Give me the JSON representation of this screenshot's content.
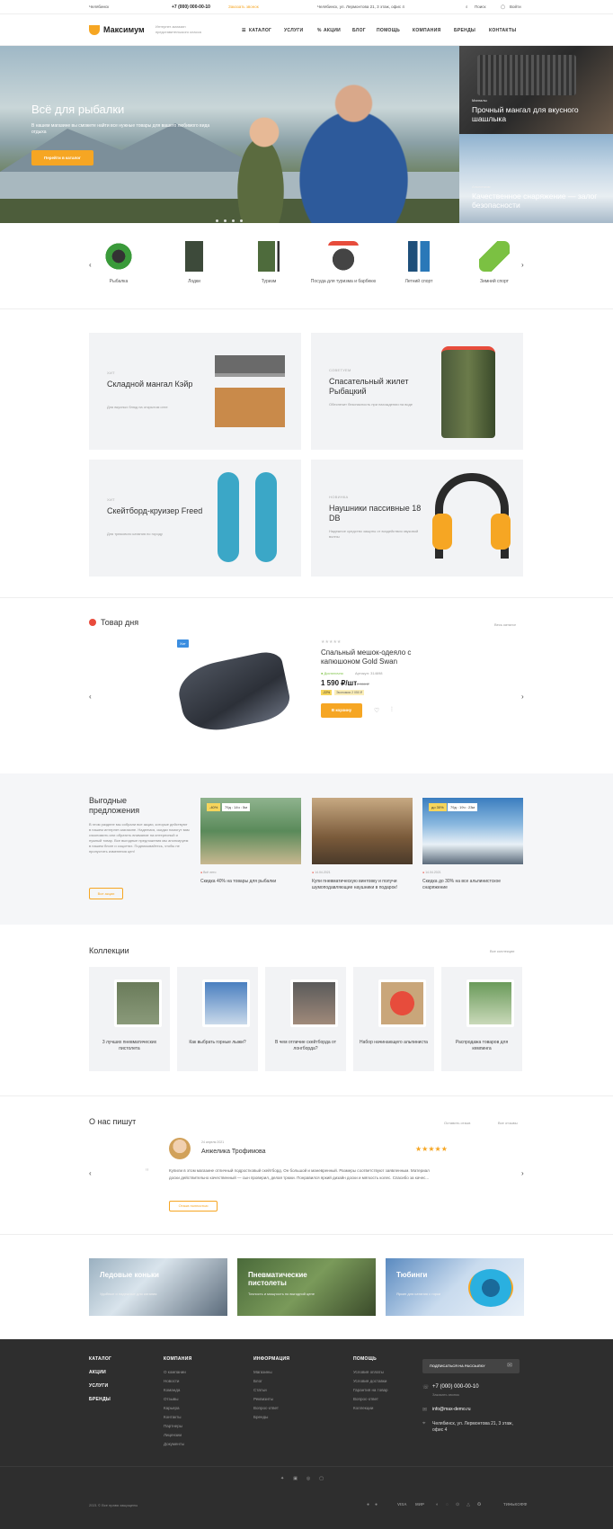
{
  "topbar": {
    "city": "Челябинск",
    "phone": "+7 (000) 000-00-10",
    "callback": "Заказать звонок",
    "address": "Челябинск, ул. Лермонтова 21, 3 этаж, офис 4",
    "search": "Поиск",
    "login": "Войти"
  },
  "brand": {
    "name": "Максимум",
    "tagline": "Интернет-магазин представительского класса",
    "accent": "#f6a623"
  },
  "nav": [
    "КАТАЛОГ",
    "УСЛУГИ",
    "АКЦИИ",
    "БЛОГ",
    "ПОМОЩЬ",
    "КОМПАНИЯ",
    "БРЕНДЫ",
    "КОНТАКТЫ"
  ],
  "hero": {
    "title": "Всё для рыбалки",
    "text": "В нашем магазине вы сможете найти все нужные товары для вашего любимого вида отдыха",
    "button": "Перейти в каталог"
  },
  "side_banners": [
    {
      "sub": "Мангалы",
      "title": "Прочный мангал для вкусного шашлыка"
    },
    {
      "sub": "Альпинизм",
      "title": "Качественное снаряжение — залог безопасности"
    }
  ],
  "categories": [
    "Рыбалка",
    "Лодки",
    "Туризм",
    "Посуда для туризма и барбекю",
    "Летний спорт",
    "Зимний спорт"
  ],
  "promos": [
    {
      "label": "ХИТ",
      "title": "Складной мангал Кэйр",
      "desc": "Для вкусных блюд на открытом огне"
    },
    {
      "label": "СОВЕТУЕМ",
      "title": "Спасательный жилет Рыбацкий",
      "desc": "Обеспечит безопасность при нахождении на воде"
    },
    {
      "label": "ХИТ",
      "title": "Скейтборд-круизер Freed",
      "desc": "Для трюкового катания по городу"
    },
    {
      "label": "НОВИНКА",
      "title": "Наушники пассивные 18 DB",
      "desc": "Надежное средство защиты от воздействия звуковой волны"
    }
  ],
  "day": {
    "title": "Товар дня",
    "all_link": "Весь каталог",
    "badge": "Хит",
    "name": "Спальный мешок-одеяло с капюшоном Gold Swan",
    "stock": "Достаточно",
    "article": "Артикул: 314698",
    "price": "1 590 ₽/шт",
    "old_price": "2 050 ₽",
    "discount": "-22%",
    "economy": "Экономия 2 050 ₽",
    "buy": "В корзину"
  },
  "offers": {
    "title": "Выгодные предложения",
    "text": "В этом разделе мы собрали все акции, которые действуют в нашем интернет-магазине. Надеемся, скидки помогут вам сэкономить или обратить внимание на интересный и нужный товар. Все выгодные предложения мы анонсируем в нашем блоге и соцсетях. Подписывайтесь, чтобы не пропустить изменения цен!",
    "button": "Все акции",
    "items": [
      {
        "badge": "-40%",
        "timer": "79д : 14ч : 5м",
        "date": "Всё лето",
        "title": "Скидка 40% на товары для рыбалки"
      },
      {
        "badge": "",
        "timer": "",
        "date": "14.04.2021",
        "title": "Купи пневматическую винтовку и получи шумоподавляющие наушники в подарок!"
      },
      {
        "badge": "до 30%",
        "timer": "79д : 19ч : 23м",
        "date": "14.04.2021",
        "title": "Скидка до 30% на все альпинистское снаряжение"
      }
    ]
  },
  "collections": {
    "title": "Коллекции",
    "all_link": "Все коллекции",
    "items": [
      "3 лучших пневматических пистолета",
      "Как выбрать горные лыжи?",
      "В чем отличие скейтборда от лонгборда?",
      "Набор начинающего альпиниста",
      "Распродажа товаров для кемпинга"
    ]
  },
  "reviews": {
    "title": "О нас пишут",
    "leave": "Оставить отзыв",
    "all_link": "Все отзывы",
    "date": "24 апреля 2021",
    "author": "Анжелика Трофимова",
    "stars": "★★★★★",
    "text": "Купили в этом магазине отличный подростковый скейтборд. Он большой и маневренный. Размеры соответствуют заявленным. Материал доски действительно качественный — сын проверил, делая трюки. Понравился яркий дизайн доски и мягкость колес. Спасибо за качес...",
    "more": "Отзыв полностью"
  },
  "banners": [
    {
      "title": "Ледовые коньки",
      "sub": "Удобные и надежные для катания"
    },
    {
      "title": "Пневматические пистолеты",
      "sub": "Точность и мощность по выгодной цене"
    },
    {
      "title": "Тюбинги",
      "sub": "Яркие для катания с горки"
    }
  ],
  "footer": {
    "main": [
      "КАТАЛОГ",
      "АКЦИИ",
      "УСЛУГИ",
      "БРЕНДЫ"
    ],
    "company": {
      "title": "КОМПАНИЯ",
      "links": [
        "О компании",
        "Новости",
        "Команда",
        "Отзывы",
        "Карьера",
        "Контакты",
        "Партнеры",
        "Лицензии",
        "Документы"
      ]
    },
    "info": {
      "title": "ИНФОРМАЦИЯ",
      "links": [
        "Магазины",
        "Блог",
        "Статьи",
        "Реквизиты",
        "Вопрос-ответ",
        "Бренды"
      ]
    },
    "help": {
      "title": "ПОМОЩЬ",
      "links": [
        "Условия оплаты",
        "Условия доставки",
        "Гарантия на товар",
        "Вопрос-ответ",
        "Коллекции"
      ]
    },
    "subscribe": "ПОДПИСАТЬСЯ НА РАССЫЛКУ",
    "phone": "+7 (000) 000-00-10",
    "callback": "Заказать звонок",
    "email": "info@max-demo.ru",
    "address": "Челябинск, ул. Лермонтова 21, 3 этаж, офис 4",
    "copyright": "2021 © Все права защищены",
    "payments": [
      "VISA",
      "МИР",
      "ТИНЬКОФФ"
    ]
  }
}
